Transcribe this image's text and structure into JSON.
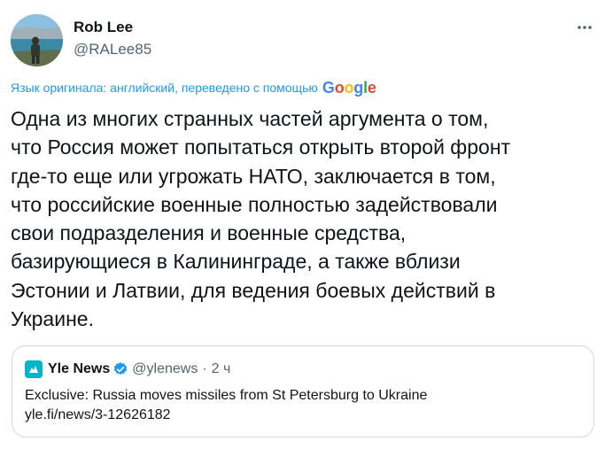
{
  "author": {
    "display_name": "Rob Lee",
    "handle": "@RALee85"
  },
  "menu": {
    "icon": "more-horizontal-icon"
  },
  "translation": {
    "note": "Язык оригинала: английский, переведено с помощью",
    "provider_logo_text": "Google"
  },
  "tweet": {
    "text": "Одна из многих странных частей аргумента о том,\nчто Россия может попытаться открыть второй фронт\nгде-то еще или угрожать НАТО, заключается в том,\nчто российские военные полностью задействовали\nсвои подразделения и военные средства,\nбазирующиеся в Калининграде, а также вблизи\nЭстонии и Латвии, для ведения боевых действий в\nУкраине."
  },
  "quote": {
    "name": "Yle News",
    "handle": "@ylenews",
    "separator": "·",
    "time": "2 ч",
    "text_line1": "Exclusive: Russia moves missiles from St Petersburg to Ukraine",
    "text_line2": "yle.fi/news/3-12626182"
  },
  "colors": {
    "accent": "#1d9bf0",
    "text_primary": "#0f1419",
    "text_secondary": "#536471",
    "border": "#cfd9de",
    "yle_brand": "#00b6c8"
  }
}
